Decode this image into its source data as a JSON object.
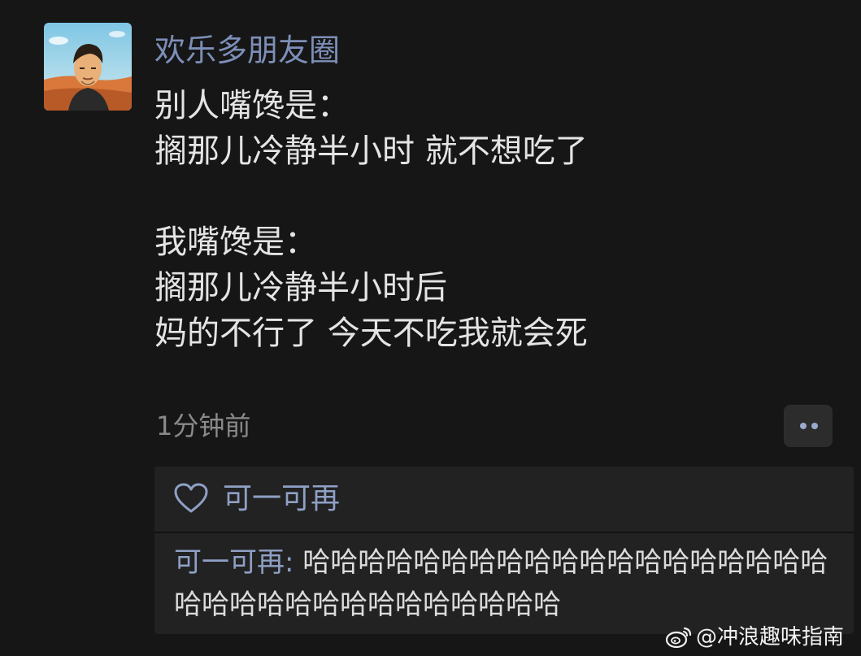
{
  "post": {
    "username": "欢乐多朋友圈",
    "lines": [
      "别人嘴馋是：",
      "搁那儿冷静半小时 就不想吃了",
      "",
      "我嘴馋是：",
      "搁那儿冷静半小时后",
      "妈的不行了 今天不吃我就会死"
    ],
    "timestamp": "1分钟前"
  },
  "interactions": {
    "liker": "可一可再",
    "comment": {
      "author": "可一可再",
      "separator": ": ",
      "text": "哈哈哈哈哈哈哈哈哈哈哈哈哈哈哈哈哈哈哈哈哈哈哈哈哈哈哈哈哈哈哈哈哈"
    }
  },
  "watermark": {
    "text": "@冲浪趣味指南",
    "icon": "weibo-icon"
  },
  "colors": {
    "background": "#161616",
    "name_link": "#7d8fb8",
    "body_text": "#e4e4e4",
    "muted": "#8a8a8a",
    "panel": "#222222"
  }
}
